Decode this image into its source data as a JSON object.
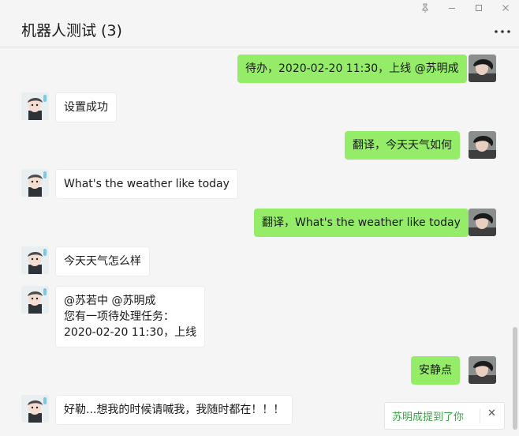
{
  "window": {
    "title": "机器人测试 (3)",
    "pin_icon": "pin-icon",
    "minimize_icon": "minimize-icon",
    "maximize_icon": "maximize-icon",
    "close_icon": "close-icon",
    "more_icon": "more-icon"
  },
  "messages": [
    {
      "sender": "self",
      "text": "待办，2020-02-20 11:30，上线 @苏明成"
    },
    {
      "sender": "bot",
      "text": "设置成功"
    },
    {
      "sender": "self",
      "text": "翻译，今天天气如何"
    },
    {
      "sender": "bot",
      "text": "What's the weather like today"
    },
    {
      "sender": "self",
      "text": "翻译，What's the weather like today"
    },
    {
      "sender": "bot",
      "text": "今天天气怎么样"
    },
    {
      "sender": "bot",
      "lines": [
        "@苏若中 @苏明成",
        "您有一项待处理任务：",
        "2020-02-20 11:30，上线"
      ]
    },
    {
      "sender": "self",
      "text": "安静点"
    },
    {
      "sender": "bot",
      "text": "好勒...想我的时候请喊我，我随时都在！！！"
    }
  ],
  "mention_toast": {
    "text": "苏明成提到了你",
    "close_label": "✕"
  },
  "colors": {
    "self_bubble": "#95ec69",
    "other_bubble": "#ffffff",
    "background": "#f5f5f5",
    "mention_text": "#3aa345"
  }
}
